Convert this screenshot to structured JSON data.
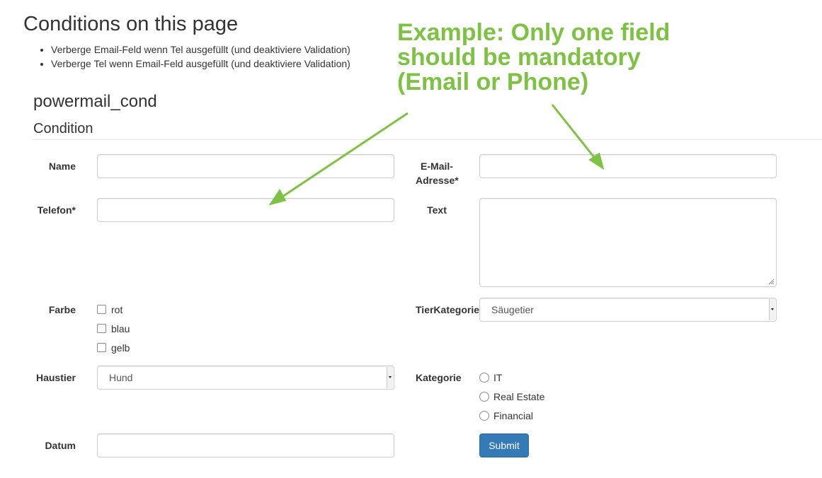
{
  "page": {
    "title": "Conditions on this page",
    "conditions": [
      "Verberge Email-Feld wenn Tel ausgefüllt (und deaktiviere Validation)",
      "Verberge Tel wenn Email-Feld ausgefüllt (und deaktiviere Validation)"
    ]
  },
  "annotation": {
    "lines": [
      "Example: Only one field",
      "should be mandatory",
      "(Email or Phone)"
    ],
    "color": "#7dc242"
  },
  "form": {
    "title": "powermail_cond",
    "legend": "Condition",
    "fields": {
      "name": {
        "label": "Name",
        "value": ""
      },
      "email": {
        "label_line1": "E-Mail-",
        "label_line2": "Adresse*",
        "value": ""
      },
      "telefon": {
        "label": "Telefon*",
        "value": ""
      },
      "text": {
        "label": "Text",
        "value": ""
      },
      "farbe": {
        "label": "Farbe",
        "options": [
          "rot",
          "blau",
          "gelb"
        ]
      },
      "tierkategorie": {
        "label": "TierKategorie",
        "selected": "Säugetier"
      },
      "haustier": {
        "label": "Haustier",
        "selected": "Hund"
      },
      "kategorie": {
        "label": "Kategorie",
        "options": [
          "IT",
          "Real Estate",
          "Financial"
        ]
      },
      "datum": {
        "label": "Datum",
        "value": ""
      }
    },
    "submit_label": "Submit"
  },
  "colors": {
    "primary_button": "#337ab7",
    "annotation_green": "#7dc242",
    "input_border": "#cccccc"
  }
}
